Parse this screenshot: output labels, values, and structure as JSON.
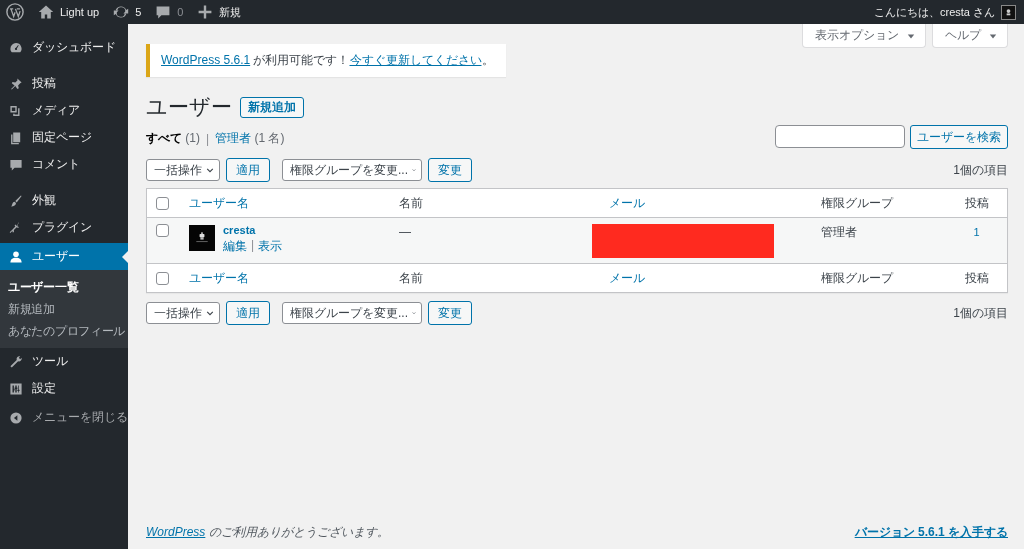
{
  "admin_bar": {
    "site": "Light up",
    "updates": "5",
    "comments": "0",
    "new": "新規",
    "greeting": "こんにちは、cresta さん"
  },
  "sidebar": {
    "items": [
      {
        "label": "ダッシュボード",
        "selected": false
      },
      {
        "label": "投稿",
        "selected": false
      },
      {
        "label": "メディア",
        "selected": false
      },
      {
        "label": "固定ページ",
        "selected": false
      },
      {
        "label": "コメント",
        "selected": false
      },
      {
        "label": "外観",
        "selected": false
      },
      {
        "label": "プラグイン",
        "selected": false
      },
      {
        "label": "ユーザー",
        "selected": true,
        "children": [
          {
            "label": "ユーザー一覧",
            "selected": true
          },
          {
            "label": "新規追加",
            "selected": false
          },
          {
            "label": "あなたのプロフィール",
            "selected": false
          }
        ]
      },
      {
        "label": "ツール",
        "selected": false
      },
      {
        "label": "設定",
        "selected": false
      }
    ],
    "collapse": "メニューを閉じる"
  },
  "screen_meta": [
    "表示オプション",
    "ヘルプ"
  ],
  "notice": [
    {
      "kind": "link",
      "text": "WordPress 5.6.1"
    },
    {
      "kind": "text",
      "text": " が利用可能です！"
    },
    {
      "kind": "link",
      "text": "今すぐ更新してください"
    },
    {
      "kind": "text",
      "text": "。"
    }
  ],
  "heading": {
    "title": "ユーザー",
    "add_new": "新規追加"
  },
  "views": [
    {
      "label": "すべて",
      "count": "(1)",
      "selected": true
    },
    {
      "separator": "|",
      "label": "管理者",
      "count": "(1 名)",
      "selected": false
    }
  ],
  "search": {
    "button": "ユーザーを検索"
  },
  "tablenav_top": {
    "bulk": "一括操作",
    "apply": "適用",
    "role": "権限グループを変更...",
    "change": "変更",
    "count": "1個の項目"
  },
  "table": {
    "select_all_checked": false,
    "columns": [
      {
        "label": "ユーザー名",
        "kind": "sortable"
      },
      {
        "label": "名前",
        "kind": "plain"
      },
      {
        "label": "メール",
        "kind": "sortable"
      },
      {
        "label": "権限グループ",
        "kind": "plain"
      },
      {
        "label": "投稿",
        "kind": "number"
      }
    ],
    "rows": [
      {
        "checked": false,
        "username": "cresta",
        "actions": [
          {
            "label": "編集"
          },
          {
            "separator": "|",
            "label": "表示"
          }
        ],
        "name": "—",
        "role": "管理者",
        "posts": "1"
      }
    ],
    "footer_select_all_checked": false,
    "footer_columns": [
      {
        "label": "ユーザー名",
        "kind": "sortable"
      },
      {
        "label": "名前",
        "kind": "plain"
      },
      {
        "label": "メール",
        "kind": "sortable"
      },
      {
        "label": "権限グループ",
        "kind": "plain"
      },
      {
        "label": "投稿",
        "kind": "number"
      }
    ]
  },
  "tablenav_bottom": {
    "bulk": "一括操作",
    "apply": "適用",
    "role": "権限グループを変更...",
    "change": "変更",
    "count": "1個の項目"
  },
  "footer": {
    "thanks": [
      {
        "kind": "link",
        "text": "WordPress"
      },
      {
        "kind": "text",
        "text": " のご利用ありがとうございます。"
      }
    ],
    "version": "バージョン 5.6.1 を入手する"
  }
}
